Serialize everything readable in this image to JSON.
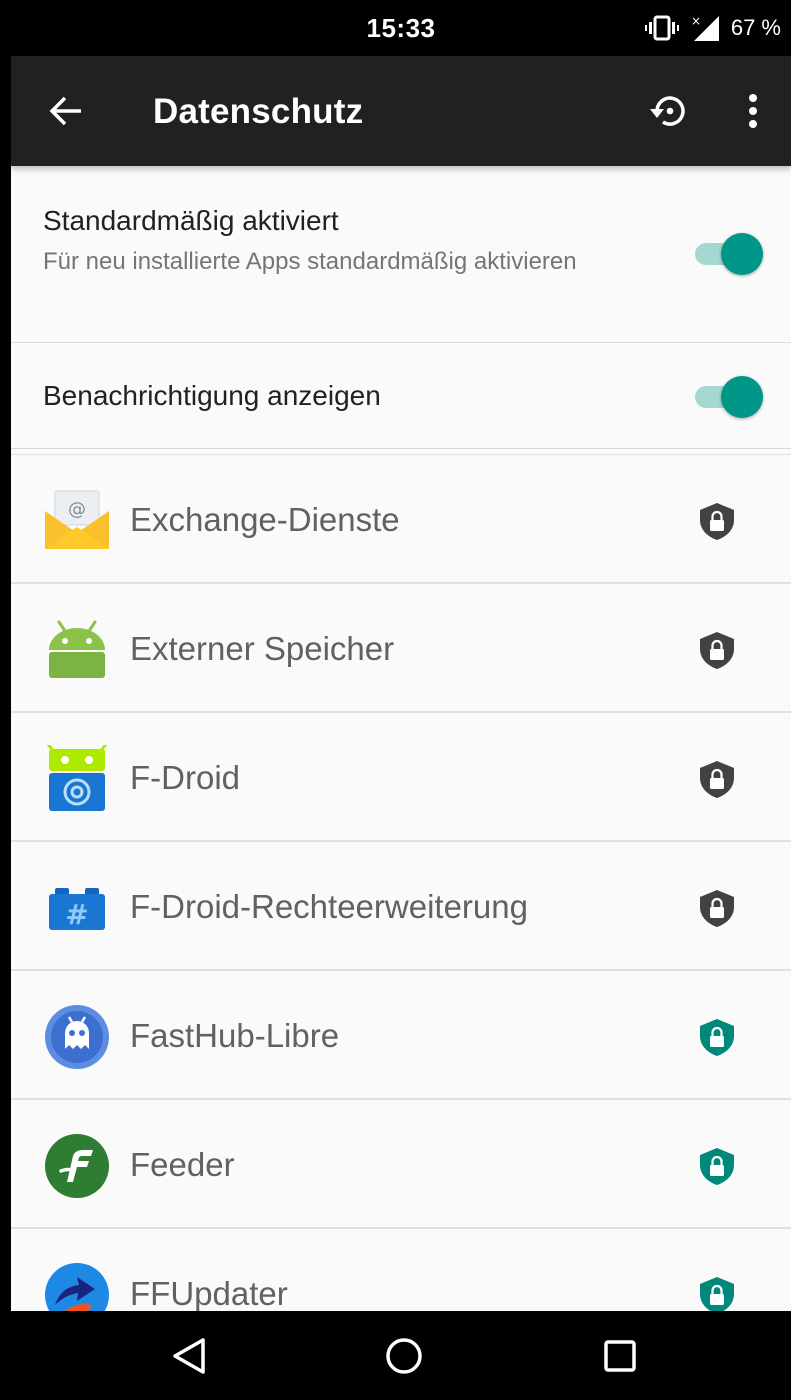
{
  "status_bar": {
    "time": "15:33",
    "battery": "67 %",
    "icons": [
      "vibrate-icon",
      "signal-icon"
    ]
  },
  "app_bar": {
    "title": "Datenschutz",
    "icons": [
      "back-arrow-icon",
      "restore-icon",
      "overflow-menu-icon"
    ]
  },
  "settings": [
    {
      "title": "Standardmäßig aktiviert",
      "summary": "Für neu installierte Apps standardmäßig aktivieren",
      "enabled": true
    },
    {
      "title": "Benachrichtigung anzeigen",
      "summary": "",
      "enabled": true
    }
  ],
  "apps": [
    {
      "name": "Exchange-Dienste",
      "icon": "exchange-mail-icon",
      "shield": "shield-lock-grey-icon"
    },
    {
      "name": "Externer Speicher",
      "icon": "android-icon",
      "shield": "shield-lock-grey-icon"
    },
    {
      "name": "F-Droid",
      "icon": "fdroid-icon",
      "shield": "shield-lock-grey-icon"
    },
    {
      "name": "F-Droid-Rechteerweiterung",
      "icon": "fdroid-privileged-icon",
      "shield": "shield-lock-grey-icon"
    },
    {
      "name": "FastHub-Libre",
      "icon": "fasthub-icon",
      "shield": "shield-lock-teal-icon"
    },
    {
      "name": "Feeder",
      "icon": "feeder-icon",
      "shield": "shield-lock-teal-icon"
    },
    {
      "name": "FFUpdater",
      "icon": "ffupdater-icon",
      "shield": "shield-lock-teal-icon"
    }
  ],
  "nav_bar": {
    "icons": [
      "back-triangle-icon",
      "home-circle-icon",
      "recents-square-icon"
    ]
  },
  "colors": {
    "accent": "#009688",
    "accent_track": "#a6d8d2",
    "app_bar": "#212121",
    "shield_grey": "#424242",
    "shield_teal": "#00897b"
  }
}
